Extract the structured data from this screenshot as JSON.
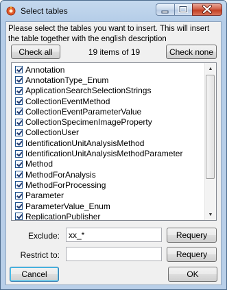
{
  "window": {
    "title": "Select tables"
  },
  "description": "Please select the tables you want to insert. This will insert the table together with the english description",
  "buttons": {
    "check_all": "Check all",
    "check_none": "Check none",
    "requery": "Requery",
    "cancel": "Cancel",
    "ok": "OK"
  },
  "count_label": "19 items of 19",
  "tables": [
    {
      "label": "Annotation",
      "checked": true
    },
    {
      "label": "AnnotationType_Enum",
      "checked": true
    },
    {
      "label": "ApplicationSearchSelectionStrings",
      "checked": true
    },
    {
      "label": "CollectionEventMethod",
      "checked": true
    },
    {
      "label": "CollectionEventParameterValue",
      "checked": true
    },
    {
      "label": "CollectionSpecimenImageProperty",
      "checked": true
    },
    {
      "label": "CollectionUser",
      "checked": true
    },
    {
      "label": "IdentificationUnitAnalysisMethod",
      "checked": true
    },
    {
      "label": "IdentificationUnitAnalysisMethodParameter",
      "checked": true
    },
    {
      "label": "Method",
      "checked": true
    },
    {
      "label": "MethodForAnalysis",
      "checked": true
    },
    {
      "label": "MethodForProcessing",
      "checked": true
    },
    {
      "label": "Parameter",
      "checked": true
    },
    {
      "label": "ParameterValue_Enum",
      "checked": true
    },
    {
      "label": "ReplicationPublisher",
      "checked": true
    }
  ],
  "exclude": {
    "label": "Exclude:",
    "value": "xx_*"
  },
  "restrict": {
    "label": "Restrict to:",
    "value": ""
  },
  "icons": {
    "app": "app-icon",
    "minimize": "minimize-icon",
    "maximize": "maximize-icon",
    "close": "close-icon"
  }
}
